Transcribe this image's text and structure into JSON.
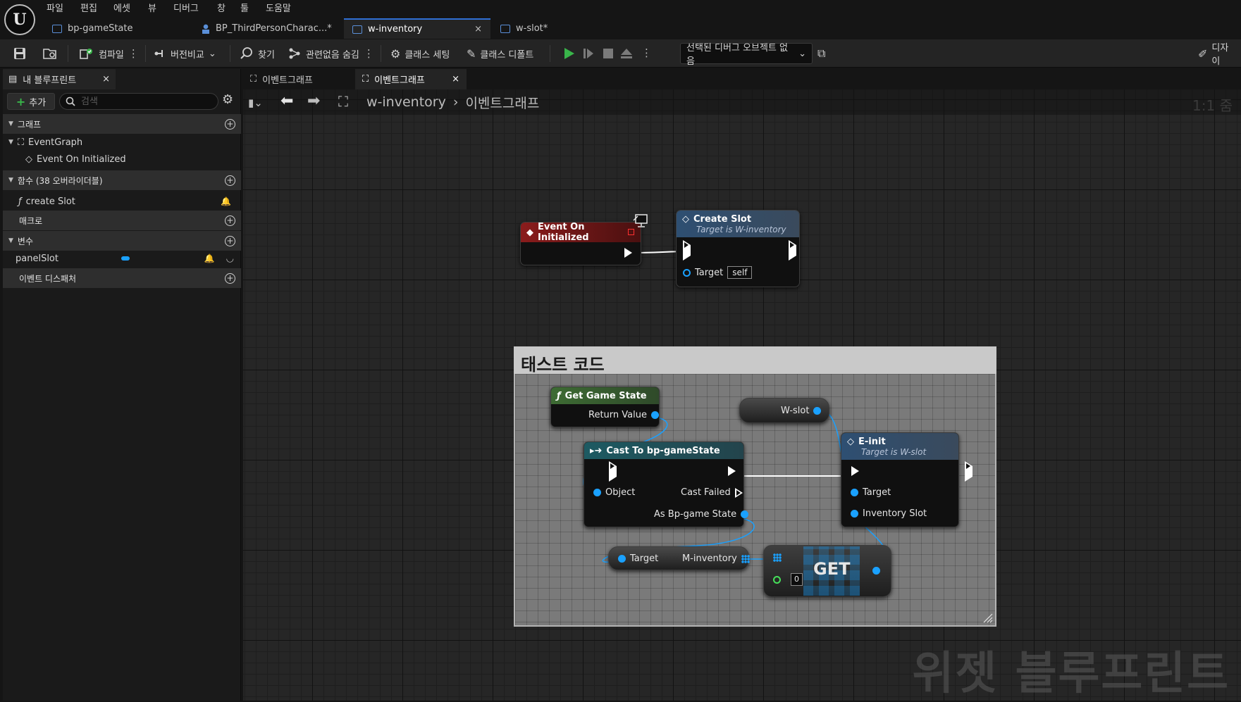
{
  "menu": [
    "파일",
    "편집",
    "에셋",
    "뷰",
    "디버그",
    "창",
    "툴",
    "도움말"
  ],
  "doc_tabs": [
    {
      "label": "bp-gameState"
    },
    {
      "label": "BP_ThirdPersonCharac...*"
    },
    {
      "label": "w-inventory",
      "close": "×"
    },
    {
      "label": "w-slot*"
    }
  ],
  "toolbar": {
    "compile": "컴파일",
    "diff": "버전비교",
    "find": "찾기",
    "hide_unrelated": "관련없음 숨김",
    "class_settings": "클래스 세팅",
    "class_defaults": "클래스 디폴트",
    "debug_object": "선택된 디버그 오브젝트 없음",
    "designer": "디자이"
  },
  "left_panel": {
    "tab": "내 블루프린트",
    "tab_close": "×",
    "add_label": "추가",
    "search_placeholder": "검색",
    "sections": {
      "graphs": "그래프",
      "functions": "함수 (38 오버라이더블)",
      "macros": "매크로",
      "variables": "변수",
      "event_dispatchers": "이벤트 디스패처"
    },
    "items": {
      "event_graph": "EventGraph",
      "event_on_initialized": "Event On Initialized",
      "create_slot": "create Slot",
      "panel_slot": "panelSlot"
    }
  },
  "graph": {
    "tabs": [
      {
        "label": "이벤트그래프"
      },
      {
        "label": "이벤트그래프",
        "close": "×"
      }
    ],
    "breadcrumb": {
      "root": "w-inventory",
      "leaf": "이벤트그래프"
    },
    "zoom": "1:1 줌",
    "watermark": "위젯 블루프린트",
    "comment_title": "태스트 코드",
    "nodes": {
      "event_on_initialized": {
        "title": "Event On Initialized"
      },
      "create_slot": {
        "title": "Create Slot",
        "subtitle": "Target is W-inventory",
        "target_label": "Target",
        "target_value": "self"
      },
      "get_game_state": {
        "title": "Get Game State",
        "return_label": "Return Value"
      },
      "w_slot": {
        "label": "W-slot"
      },
      "cast": {
        "title": "Cast To bp-gameState",
        "object_label": "Object",
        "cast_failed": "Cast Failed",
        "as_label": "As Bp-game State"
      },
      "e_init": {
        "title": "E-init",
        "subtitle": "Target is W-slot",
        "target_label": "Target",
        "inventory_slot_label": "Inventory Slot"
      },
      "m_inventory": {
        "target_label": "Target",
        "var_label": "M-inventory"
      },
      "get": {
        "label": "GET",
        "index_value": "0"
      }
    }
  },
  "colors": {
    "event_header": "#8a1c1c",
    "function_header": "#2e4f72",
    "pure_header": "#3d6b33",
    "cast_header": "#1d5a62",
    "object_pin": "#1aa1ff",
    "int_pin": "#46e05a",
    "tab_accent": "#2f6fd6"
  }
}
